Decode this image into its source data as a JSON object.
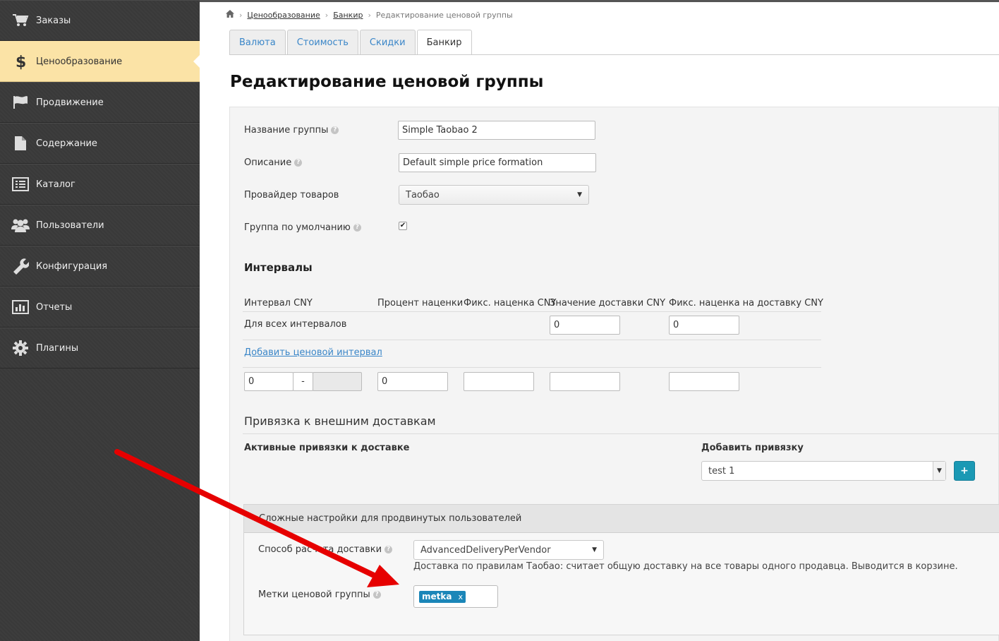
{
  "sidebar": {
    "items": [
      {
        "label": "Заказы",
        "icon": "cart-icon"
      },
      {
        "label": "Ценообразование",
        "icon": "dollar-icon"
      },
      {
        "label": "Продвижение",
        "icon": "flag-icon"
      },
      {
        "label": "Содержание",
        "icon": "document-icon"
      },
      {
        "label": "Каталог",
        "icon": "list-icon"
      },
      {
        "label": "Пользователи",
        "icon": "users-icon"
      },
      {
        "label": "Конфигурация",
        "icon": "wrench-icon"
      },
      {
        "label": "Отчеты",
        "icon": "bar-chart-icon"
      },
      {
        "label": "Плагины",
        "icon": "gear-icon"
      }
    ]
  },
  "breadcrumb": {
    "home_icon": "home-icon",
    "items": [
      "Ценообразование",
      "Банкир",
      "Редактирование ценовой группы"
    ]
  },
  "tabs": [
    "Валюта",
    "Стоимость",
    "Скидки",
    "Банкир"
  ],
  "page_title": "Редактирование ценовой группы",
  "form": {
    "group_name": {
      "label": "Название группы",
      "value": "Simple Taobao 2"
    },
    "description": {
      "label": "Описание",
      "value": "Default simple price formation"
    },
    "provider": {
      "label": "Провайдер товаров",
      "value": "Таобао"
    },
    "default_group": {
      "label": "Группа по умолчанию",
      "checked": true,
      "check_glyph": "✔"
    }
  },
  "intervals": {
    "heading": "Интервалы",
    "columns": [
      "Интервал CNY",
      "Процент наценки",
      "Фикс. наценка CNY",
      "Значение доставки CNY",
      "Фикс. наценка на доставку CNY"
    ],
    "all_intervals_label": "Для всех интервалов",
    "all_delivery_value": "0",
    "all_delivery_fixed": "0",
    "add_link": "Добавить ценовой интервал",
    "new_row": {
      "from": "0",
      "dash": "-",
      "to": "",
      "percent": "0",
      "fixed": "",
      "delivery": "",
      "delivery_fixed": ""
    }
  },
  "external": {
    "heading": "Привязка к внешним доставкам",
    "active_label": "Активные привязки к доставке",
    "add_label": "Добавить привязку",
    "add_select": "test 1",
    "add_button": "+"
  },
  "advanced": {
    "header": "Сложные настройки для продвинутых пользователей",
    "delivery_method": {
      "label": "Способ расчета доставки",
      "value": "AdvancedDeliveryPerVendor"
    },
    "delivery_hint": "Доставка по правилам Таобао: считает общую доставку на все товары одного продавца. Выводится в корзине.",
    "tags": {
      "label": "Метки ценовой группы",
      "items": [
        {
          "text": "metka",
          "remove": "x"
        }
      ]
    }
  },
  "colors": {
    "active_nav": "#fbe3a6",
    "link": "#3a86c8",
    "accent": "#1b99b4",
    "arrow": "#e60000"
  }
}
